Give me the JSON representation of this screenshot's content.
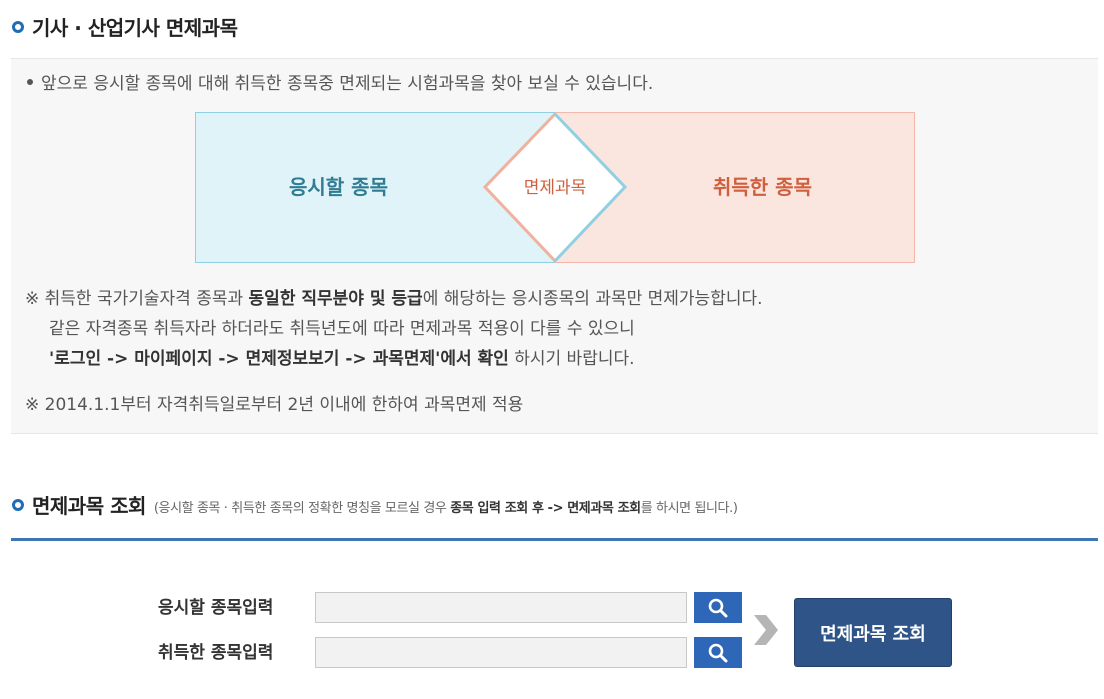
{
  "section1": {
    "title": "기사 · 산업기사 면제과목",
    "intro": "앞으로 응시할 종목에 대해 취득한 종목중 면제되는 시험과목을 찾아 보실 수 있습니다.",
    "diagram": {
      "left_label": "응시할 종목",
      "center_label": "면제과목",
      "right_label": "취득한 종목"
    },
    "note1": {
      "line1_pre": "※ 취득한 국가기술자격 종목과 ",
      "line1_bold": "동일한 직무분야 및 등급",
      "line1_post": "에 해당하는 응시종목의 과목만 면제가능합니다.",
      "line2": "같은 자격종목 취득자라 하더라도 취득년도에 따라 면제과목 적용이 다를 수 있으니",
      "line3_bold": "'로그인 -> 마이페이지 -> 면제정보보기 -> 과목면제'에서 확인",
      "line3_post": " 하시기 바랍니다."
    },
    "note2": "※ 2014.1.1부터 자격취득일로부터 2년 이내에 한하여 과목면제 적용"
  },
  "section2": {
    "title": "면제과목 조회",
    "desc_pre": "(응시할 종목 · 취득한 종목의 정확한 명칭을 모르실 경우 ",
    "desc_bold1": "종목 입력 조회 후 -> 면제과목 조회",
    "desc_post": "를 하시면 됩니다.)"
  },
  "form": {
    "label_apply": "응시할 종목입력",
    "label_acquired": "취득한 종목입력",
    "value_apply": "",
    "value_acquired": "",
    "submit_label": "면제과목 조회"
  },
  "colors": {
    "accent_blue": "#2f67b8",
    "submit_navy": "#2f5487",
    "teal_text": "#2f7c93",
    "orange_text": "#d0603d"
  },
  "icons": {
    "heading_bullet": "ring-bullet-icon",
    "search": "search-icon",
    "arrow": "chevron-right-icon"
  }
}
